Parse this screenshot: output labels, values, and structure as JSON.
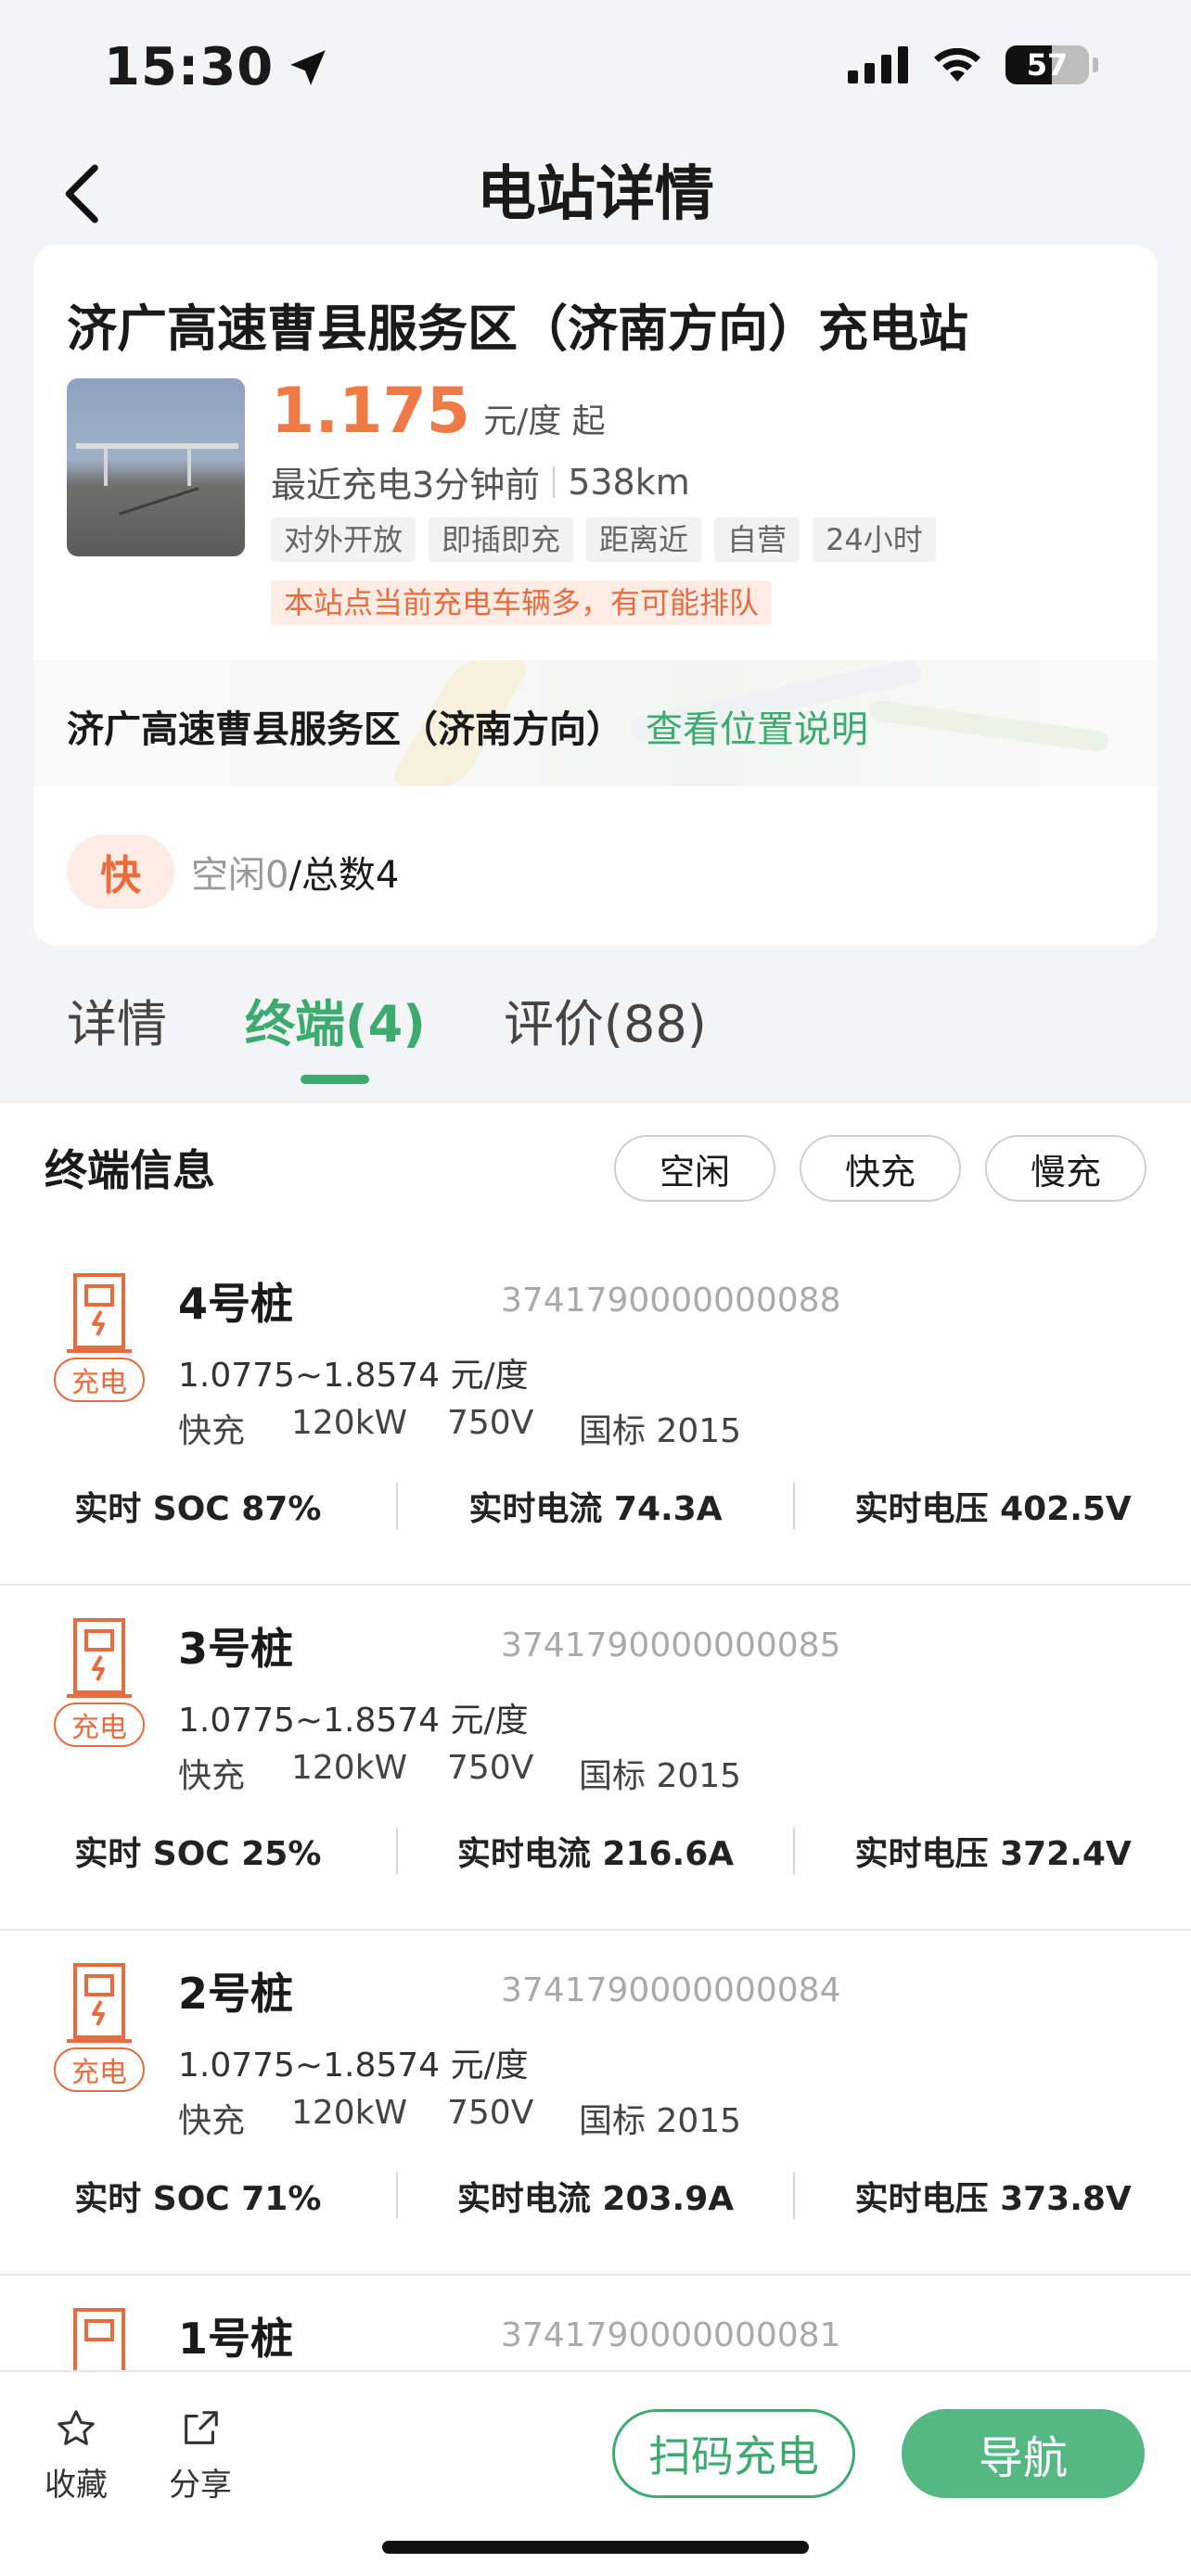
{
  "status": {
    "time": "15:30",
    "battery": "57"
  },
  "nav": {
    "title": "电站详情"
  },
  "station": {
    "name": "济广高速曹县服务区（济南方向）充电站",
    "price": "1.175",
    "price_unit": "元/度 起",
    "recent": "最近充电3分钟前",
    "distance": "538km",
    "tags": [
      "对外开放",
      "即插即充",
      "距离近",
      "自营",
      "24小时"
    ],
    "warning": "本站点当前充电车辆多，有可能排队",
    "address": "济广高速曹县服务区（济南方向）",
    "address_link": "查看位置说明",
    "fast_label": "快",
    "idle_text": "空闲0",
    "total_text": "/总数4"
  },
  "tabs": [
    {
      "label": "详情"
    },
    {
      "label": "终端(4)"
    },
    {
      "label": "评价(88)"
    }
  ],
  "terminals": {
    "title": "终端信息",
    "filters": [
      "空闲",
      "快充",
      "慢充"
    ],
    "piles": [
      {
        "name": "4号桩",
        "id": "3741790000000088",
        "status": "充电",
        "price": "1.0775~1.8574 元/度",
        "type": "快充",
        "power": "120kW",
        "voltage": "750V",
        "standard": "国标 2015",
        "soc": "实时 SOC 87%",
        "current": "实时电流 74.3A",
        "volt_rt": "实时电压 402.5V"
      },
      {
        "name": "3号桩",
        "id": "3741790000000085",
        "status": "充电",
        "price": "1.0775~1.8574 元/度",
        "type": "快充",
        "power": "120kW",
        "voltage": "750V",
        "standard": "国标 2015",
        "soc": "实时 SOC 25%",
        "current": "实时电流 216.6A",
        "volt_rt": "实时电压 372.4V"
      },
      {
        "name": "2号桩",
        "id": "3741790000000084",
        "status": "充电",
        "price": "1.0775~1.8574 元/度",
        "type": "快充",
        "power": "120kW",
        "voltage": "750V",
        "standard": "国标 2015",
        "soc": "实时 SOC 71%",
        "current": "实时电流 203.9A",
        "volt_rt": "实时电压 373.8V"
      },
      {
        "name": "1号桩",
        "id": "3741790000000081"
      }
    ]
  },
  "bottom": {
    "favorite": "收藏",
    "share": "分享",
    "scan": "扫码充电",
    "navigate": "导航"
  },
  "colors": {
    "accent_green": "#3dab70",
    "accent_orange": "#ee7a45"
  }
}
